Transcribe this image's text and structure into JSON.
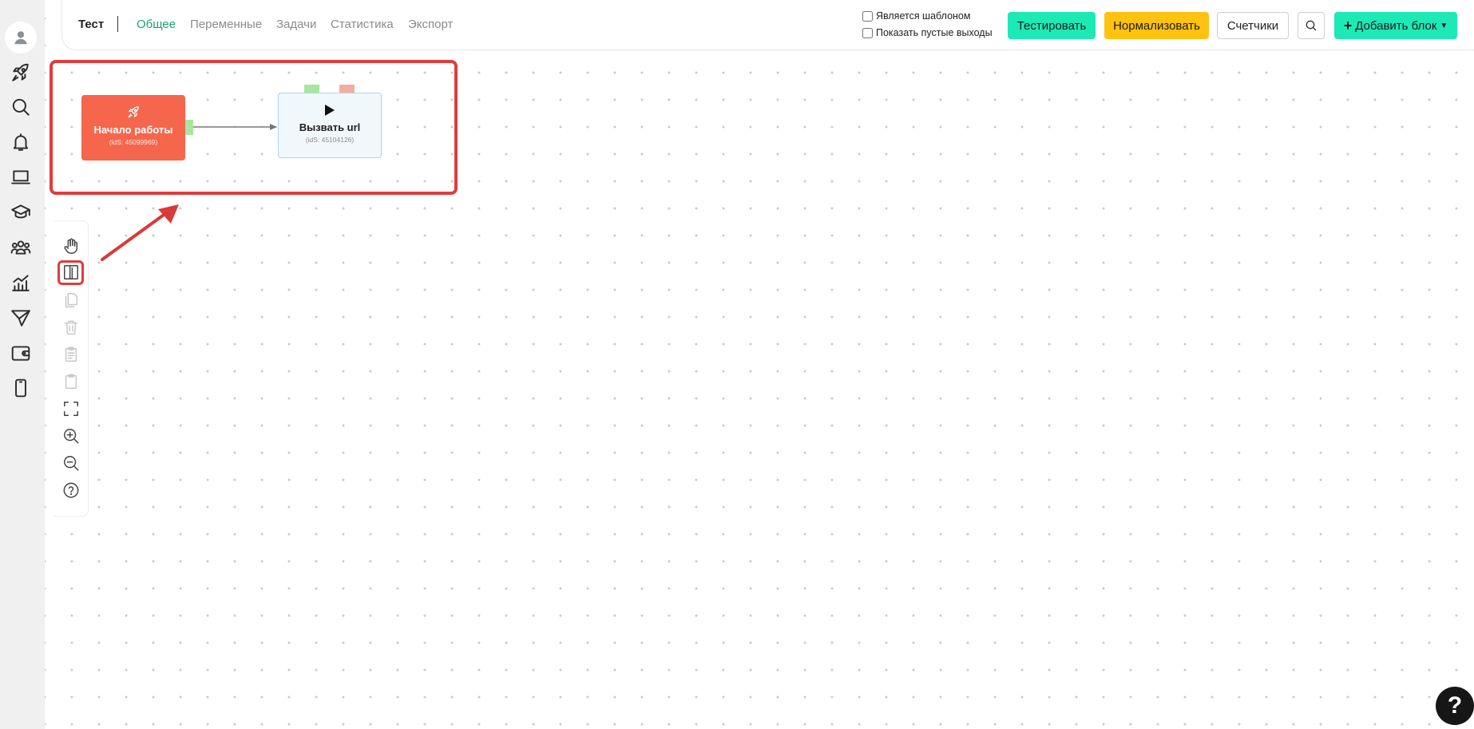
{
  "sidebar": {
    "items": [
      {
        "name": "avatar",
        "icon": "user-icon"
      },
      {
        "name": "rocket",
        "icon": "rocket-icon"
      },
      {
        "name": "search",
        "icon": "search-icon"
      },
      {
        "name": "notifications",
        "icon": "bell-icon"
      },
      {
        "name": "laptop",
        "icon": "laptop-icon"
      },
      {
        "name": "education",
        "icon": "graduation-cap-icon"
      },
      {
        "name": "users",
        "icon": "users-icon"
      },
      {
        "name": "analytics",
        "icon": "chart-icon"
      },
      {
        "name": "send",
        "icon": "paper-plane-icon"
      },
      {
        "name": "wallet",
        "icon": "wallet-icon"
      },
      {
        "name": "mobile",
        "icon": "phone-icon"
      }
    ]
  },
  "header": {
    "title": "Тест",
    "tabs": [
      {
        "label": "Общее",
        "active": true
      },
      {
        "label": "Переменные",
        "active": false
      },
      {
        "label": "Задачи",
        "active": false
      },
      {
        "label": "Статистика",
        "active": false
      },
      {
        "label": "Экспорт",
        "active": false
      }
    ],
    "checkboxes": {
      "is_template": "Является шаблоном",
      "show_empty_outputs": "Показать пустые выходы"
    },
    "buttons": {
      "test": "Тестировать",
      "normalize": "Нормализовать",
      "counters": "Счетчики",
      "add_block": "Добавить блок"
    }
  },
  "flow": {
    "start_node": {
      "title": "Начало работы",
      "id_text": "(idS: 45099969)"
    },
    "url_node": {
      "title": "Вызвать url",
      "id_text": "(idS: 45104126)"
    }
  },
  "toolbar": {
    "tools": [
      {
        "name": "pan-tool",
        "icon": "hand-icon",
        "enabled": true
      },
      {
        "name": "select-tool",
        "icon": "select-frame-icon",
        "enabled": true,
        "highlighted": true
      },
      {
        "name": "copy-tool",
        "icon": "copy-icon",
        "enabled": false
      },
      {
        "name": "delete-tool",
        "icon": "trash-icon",
        "enabled": false
      },
      {
        "name": "clipboard-tool",
        "icon": "clipboard-icon",
        "enabled": false
      },
      {
        "name": "paste-tool",
        "icon": "paste-icon",
        "enabled": false
      },
      {
        "name": "fit-tool",
        "icon": "fullscreen-icon",
        "enabled": true
      },
      {
        "name": "zoom-in-tool",
        "icon": "zoom-in-icon",
        "enabled": true
      },
      {
        "name": "zoom-out-tool",
        "icon": "zoom-out-icon",
        "enabled": true
      },
      {
        "name": "help-tool",
        "icon": "question-icon",
        "enabled": true
      }
    ]
  },
  "help_bubble": {
    "label": "?"
  },
  "colors": {
    "accent_green": "#1de9b6",
    "accent_yellow": "#ffc20e",
    "active_tab": "#1aa374",
    "start_node": "#f5664c",
    "highlight": "#e03c3c"
  }
}
